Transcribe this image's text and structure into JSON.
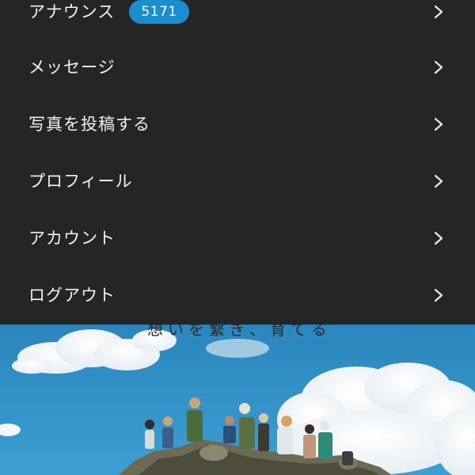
{
  "menu": {
    "items": [
      {
        "label": "アナウンス",
        "badge": "5171",
        "icon": "chevron-right-icon"
      },
      {
        "label": "メッセージ",
        "icon": "chevron-right-icon"
      },
      {
        "label": "写真を投稿する",
        "icon": "chevron-right-icon"
      },
      {
        "label": "プロフィール",
        "icon": "chevron-right-icon"
      },
      {
        "label": "アカウント",
        "icon": "chevron-right-icon"
      },
      {
        "label": "ログアウト",
        "icon": "chevron-right-icon"
      }
    ]
  },
  "hero": {
    "tagline": "想いを繋ぎ、育てる"
  },
  "colors": {
    "menu_background": "#252525",
    "menu_text": "#f2f2f2",
    "badge_background": "#1a8fd0",
    "sky": "#2e8fc4"
  }
}
